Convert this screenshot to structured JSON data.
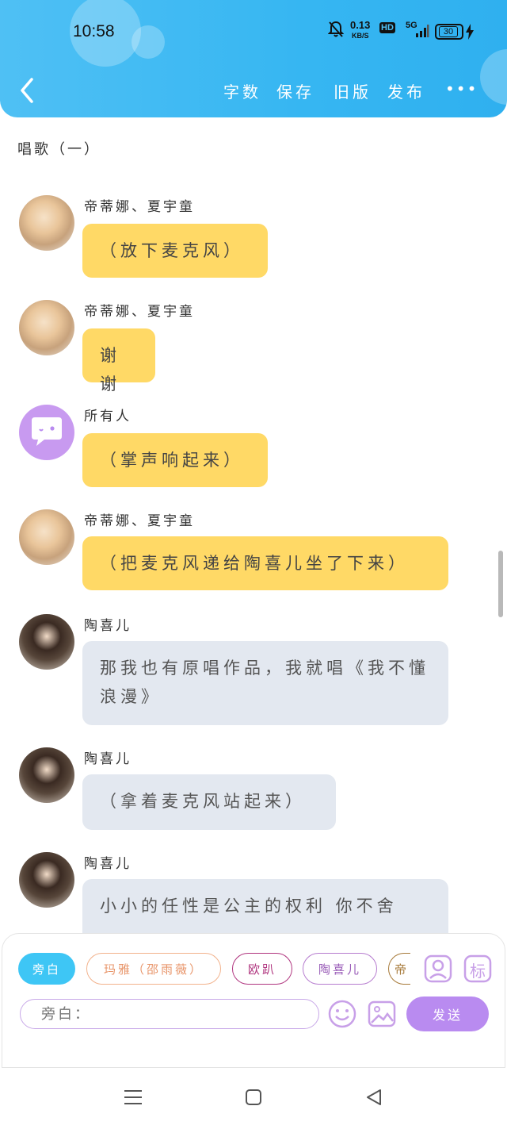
{
  "status_bar": {
    "time": "10:58",
    "net_speed_value": "0.13",
    "net_speed_unit": "KB/S",
    "hd": "HD",
    "network": "5G",
    "battery": "30"
  },
  "nav": {
    "word_count": "字数",
    "save": "保存",
    "old_version": "旧版",
    "publish": "发布",
    "more": "•••"
  },
  "chat": {
    "title": "唱歌（一）",
    "messages": [
      {
        "sender": "帝蒂娜、夏宇童",
        "text": "（放下麦克风）"
      },
      {
        "sender": "帝蒂娜、夏宇童",
        "text": "谢谢"
      },
      {
        "sender": "所有人",
        "text": "（掌声响起来）"
      },
      {
        "sender": "帝蒂娜、夏宇童",
        "text": "（把麦克风递给陶喜儿坐了下来）"
      },
      {
        "sender": "陶喜儿",
        "text": "那我也有原唱作品，我就唱《我不懂浪漫》"
      },
      {
        "sender": "陶喜儿",
        "text": "（拿着麦克风站起来）"
      },
      {
        "sender": "陶喜儿",
        "text": "小小的任性是公主的权利 你不舍"
      }
    ]
  },
  "roles": {
    "narrator": "旁白",
    "role1": "玛雅（邵雨薇）",
    "role2": "欧趴",
    "role3": "陶喜儿",
    "role4_partial": "帝"
  },
  "input": {
    "placeholder": "旁白："
  },
  "send_label": "发送",
  "mark_label": "标",
  "colors": {
    "header": "#36b6f2",
    "yellow_bubble": "#ffd966",
    "grey_bubble": "#e3e8f0",
    "send": "#b98bf0",
    "narrator_btn": "#3ec6f5"
  }
}
